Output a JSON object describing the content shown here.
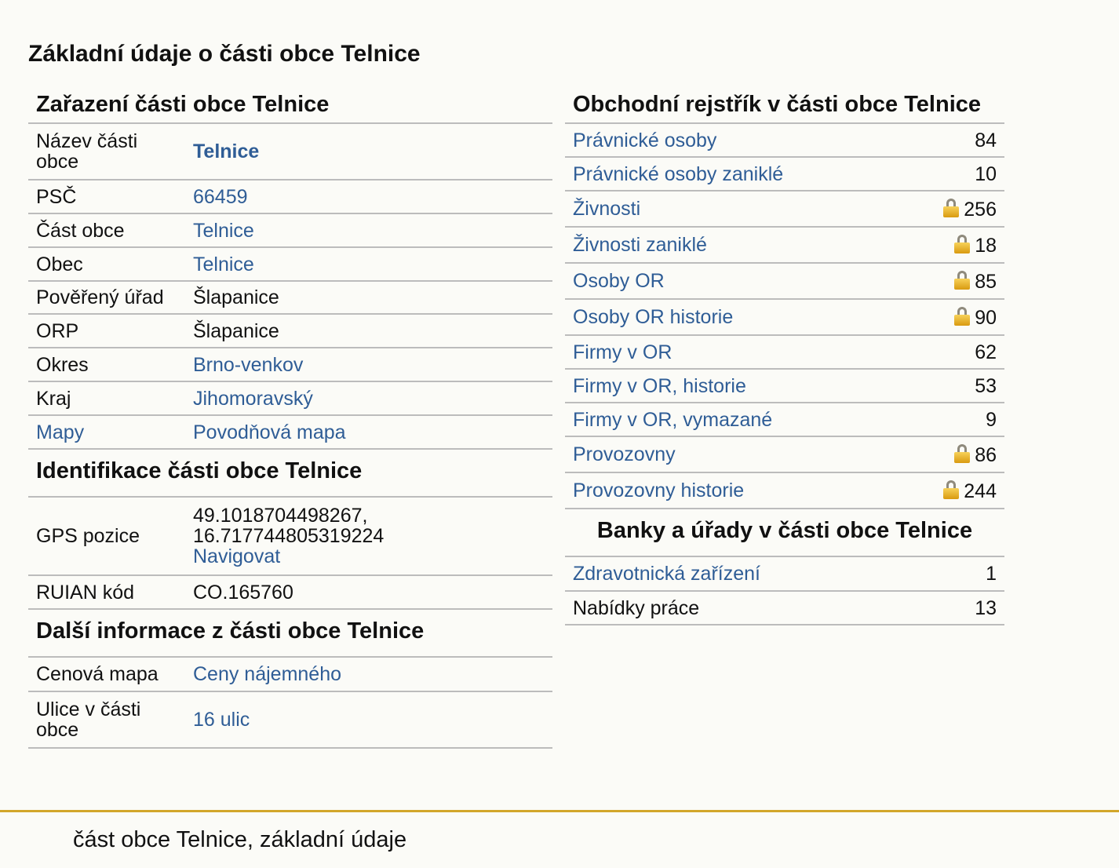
{
  "page_title": "Základní údaje o části obce Telnice",
  "zarazeni": {
    "heading": "Zařazení části obce Telnice",
    "rows": [
      {
        "key": "Název části obce",
        "value": "Telnice"
      },
      {
        "key": "PSČ",
        "value": "66459"
      },
      {
        "key": "Část obce",
        "value": "Telnice"
      },
      {
        "key": "Obec",
        "value": "Telnice"
      },
      {
        "key": "Pověřený úřad",
        "value": "Šlapanice"
      },
      {
        "key": "ORP",
        "value": "Šlapanice"
      },
      {
        "key": "Okres",
        "value": "Brno-venkov"
      },
      {
        "key": "Kraj",
        "value": "Jihomoravský"
      },
      {
        "key": "Mapy",
        "value": "Povodňová mapa"
      }
    ]
  },
  "identifikace": {
    "heading": "Identifikace části obce Telnice",
    "gps_key": "GPS pozice",
    "gps_line1": "49.1018704498267,",
    "gps_line2": "16.717744805319224",
    "gps_link": "Navigovat",
    "ruian_key": "RUIAN kód",
    "ruian_value": "CO.165760"
  },
  "dalsi": {
    "heading": "Další informace z části obce Telnice",
    "rows": [
      {
        "key": "Cenová mapa",
        "value": "Ceny nájemného"
      },
      {
        "key": "Ulice v části obce",
        "value": "16 ulic"
      }
    ]
  },
  "obchodni": {
    "heading": "Obchodní rejstřík v části obce Telnice",
    "rows": [
      {
        "label": "Právnické osoby",
        "count": "84"
      },
      {
        "label": "Právnické osoby zaniklé",
        "count": "10"
      },
      {
        "label": "Živnosti",
        "count": "256"
      },
      {
        "label": "Živnosti zaniklé",
        "count": "18"
      },
      {
        "label": "Osoby OR",
        "count": "85"
      },
      {
        "label": "Osoby OR historie",
        "count": "90"
      },
      {
        "label": "Firmy v OR",
        "count": "62"
      },
      {
        "label": "Firmy v OR, historie",
        "count": "53"
      },
      {
        "label": "Firmy v OR, vymazané",
        "count": "9"
      },
      {
        "label": "Provozovny",
        "count": "86"
      },
      {
        "label": "Provozovny historie",
        "count": "244"
      }
    ]
  },
  "banky": {
    "heading": "Banky a úřady v části obce Telnice",
    "rows": [
      {
        "label": "Zdravotnická zařízení",
        "count": "1"
      },
      {
        "label": "Nabídky práce",
        "count": "13"
      }
    ]
  },
  "icons": {
    "lock": "lock-icon"
  },
  "colors": {
    "link": "#2f5d96",
    "footer_rule": "#d2a62b"
  },
  "footer": {
    "text": "část obce Telnice, základní údaje"
  }
}
